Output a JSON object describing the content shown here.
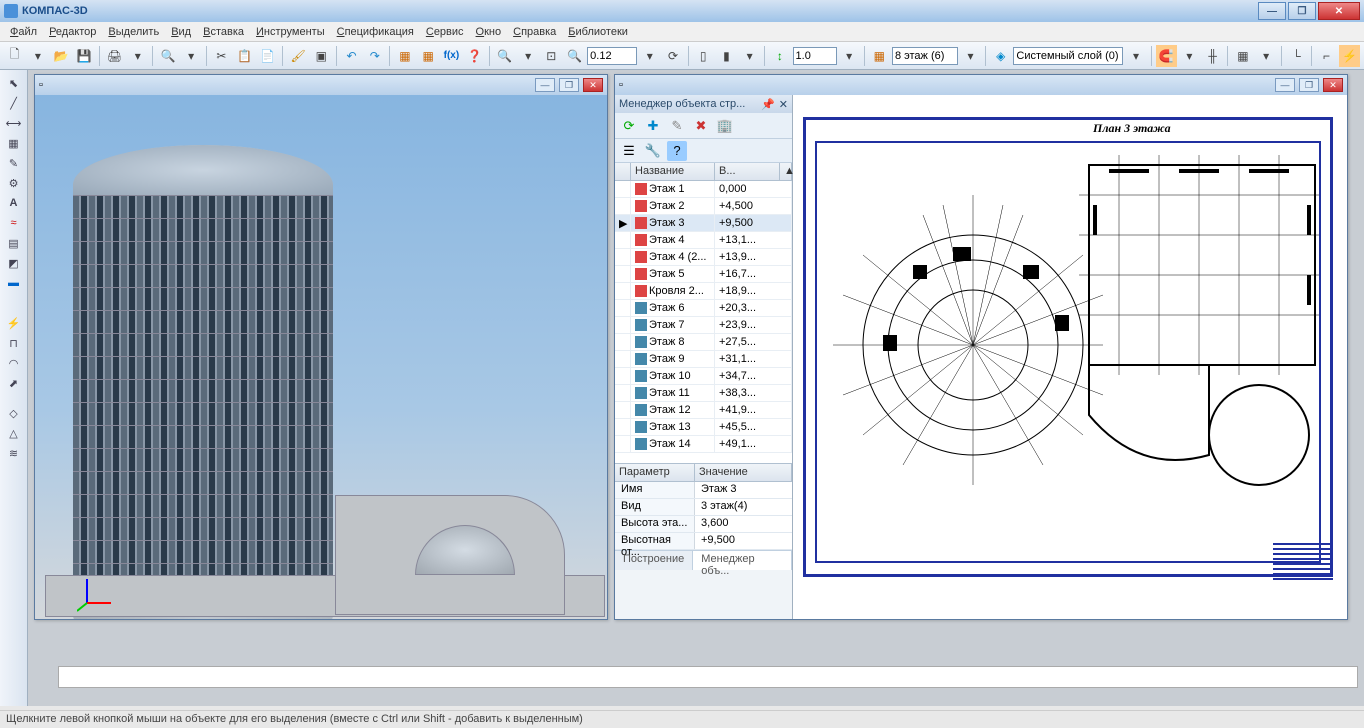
{
  "app": {
    "title": "КОМПАС-3D"
  },
  "menu": [
    "Файл",
    "Редактор",
    "Выделить",
    "Вид",
    "Вставка",
    "Инструменты",
    "Спецификация",
    "Сервис",
    "Окно",
    "Справка",
    "Библиотеки"
  ],
  "toolbar": {
    "zoom_value": "0.12",
    "scale_value": "1.0",
    "floor_value": "8 этаж (6)",
    "layer_value": "Системный слой (0)"
  },
  "panel": {
    "title": "Менеджер объекта стр...",
    "col_name": "Название",
    "col_val": "В...",
    "rows": [
      {
        "name": "Этаж 1",
        "val": "0,000",
        "ic": "red"
      },
      {
        "name": "Этаж 2",
        "val": "+4,500",
        "ic": "red"
      },
      {
        "name": "Этаж 3",
        "val": "+9,500",
        "ic": "red",
        "sel": true
      },
      {
        "name": "Этаж 4",
        "val": "+13,1...",
        "ic": "red"
      },
      {
        "name": "Этаж 4 (2...",
        "val": "+13,9...",
        "ic": "red"
      },
      {
        "name": "Этаж 5",
        "val": "+16,7...",
        "ic": "red"
      },
      {
        "name": "Кровля 2...",
        "val": "+18,9...",
        "ic": "red"
      },
      {
        "name": "Этаж 6",
        "val": "+20,3...",
        "ic": "blue"
      },
      {
        "name": "Этаж 7",
        "val": "+23,9...",
        "ic": "blue"
      },
      {
        "name": "Этаж 8",
        "val": "+27,5...",
        "ic": "blue"
      },
      {
        "name": "Этаж 9",
        "val": "+31,1...",
        "ic": "blue"
      },
      {
        "name": "Этаж 10",
        "val": "+34,7...",
        "ic": "blue"
      },
      {
        "name": "Этаж 11",
        "val": "+38,3...",
        "ic": "blue"
      },
      {
        "name": "Этаж 12",
        "val": "+41,9...",
        "ic": "blue"
      },
      {
        "name": "Этаж 13",
        "val": "+45,5...",
        "ic": "blue"
      },
      {
        "name": "Этаж 14",
        "val": "+49,1...",
        "ic": "blue"
      }
    ],
    "prop_header": {
      "p": "Параметр",
      "v": "Значение"
    },
    "props": [
      {
        "p": "Имя",
        "v": "Этаж 3"
      },
      {
        "p": "Вид",
        "v": "3 этаж(4)"
      },
      {
        "p": "Высота эта...",
        "v": "3,600"
      },
      {
        "p": "Высотная от...",
        "v": "+9,500"
      }
    ],
    "tabs": [
      "Построение",
      "Менеджер объ..."
    ]
  },
  "plan": {
    "title": "План 3 этажа"
  },
  "status": "Щелкните левой кнопкой мыши на объекте для его выделения (вместе с Ctrl или Shift - добавить к выделенным)"
}
